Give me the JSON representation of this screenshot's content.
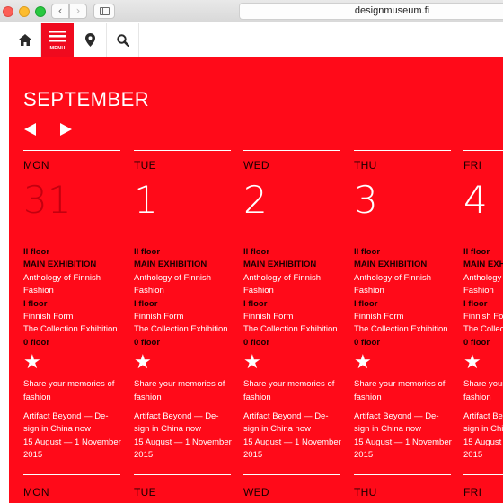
{
  "browser": {
    "url": "designmuseum.fi",
    "back_glyph": "‹",
    "forward_glyph": "›"
  },
  "nav": {
    "menu_label": "MENU",
    "icons": [
      "home-icon",
      "menu-icon",
      "location-pin-icon",
      "search-icon"
    ]
  },
  "calendar": {
    "month": "SEPTEMBER",
    "days": [
      {
        "name": "MON",
        "number": "31",
        "past": true
      },
      {
        "name": "TUE",
        "number": "1",
        "past": false
      },
      {
        "name": "WED",
        "number": "2",
        "past": false
      },
      {
        "name": "THU",
        "number": "3",
        "past": false
      },
      {
        "name": "FRI",
        "number": "4",
        "past": false
      }
    ],
    "next_row_days": [
      "MON",
      "TUE",
      "WED",
      "THU",
      "FRI"
    ],
    "event": {
      "floor2": "II floor",
      "main_exhibition": "MAIN EXHIBITION",
      "anthology_1": "Anthology of Finnish",
      "anthology_2": "Fashion",
      "floor1": "I floor",
      "finnish_form": "Finnish Form",
      "collection": "The Collection Exhibition",
      "floor0": "0 floor",
      "star": "★",
      "share_1": "Share your memories of",
      "share_2": "fashion",
      "artifact_1": "Artifact Beyond — De-",
      "artifact_2": "sign in China now",
      "dates_1": "15 August — 1 November",
      "dates_2": "2015"
    }
  },
  "colors": {
    "brand_red": "#ff0a19",
    "past_day": "#c3000f",
    "dark_text": "#1a0000"
  }
}
